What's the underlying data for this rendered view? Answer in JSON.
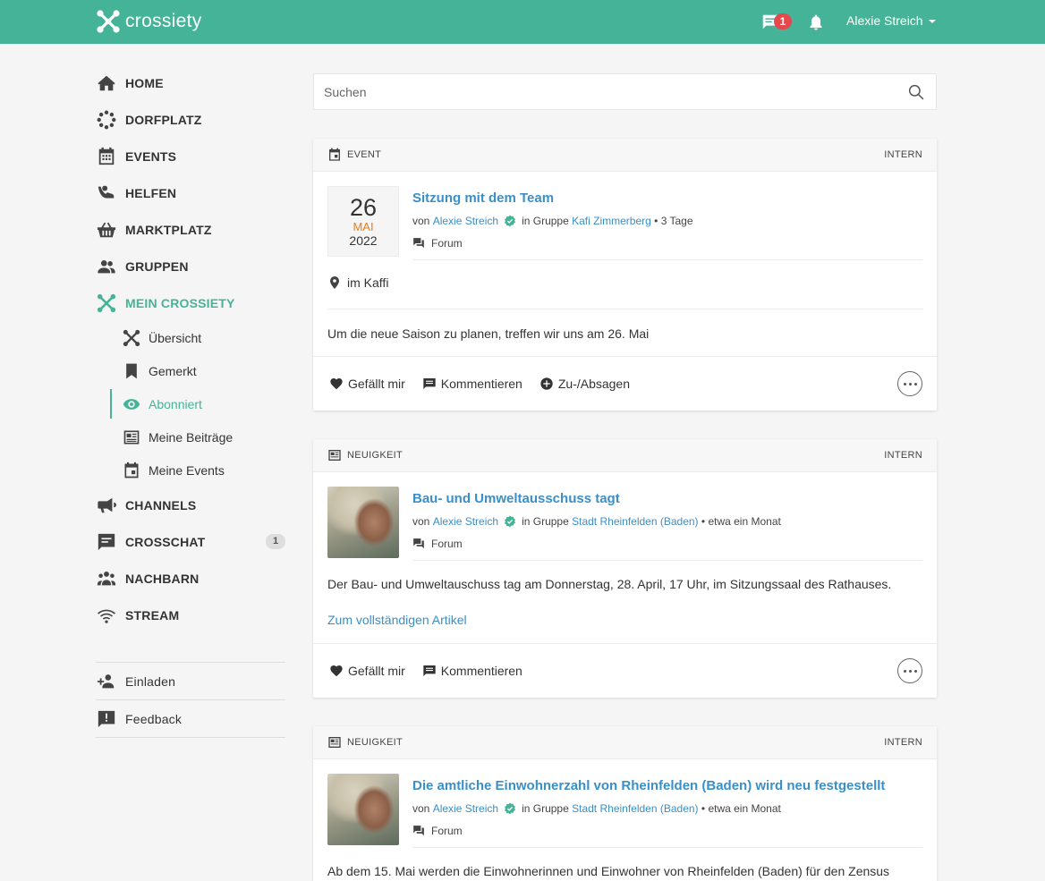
{
  "app": {
    "name": "crossiety",
    "brand_color": "#45b397",
    "message_count": "1",
    "user_name": "Alexie Streich"
  },
  "sidebar": {
    "items": [
      {
        "label": "HOME",
        "icon": "home-icon"
      },
      {
        "label": "DORFPLATZ",
        "icon": "dots-circle-icon"
      },
      {
        "label": "EVENTS",
        "icon": "calendar-icon"
      },
      {
        "label": "HELFEN",
        "icon": "helping-hand-icon"
      },
      {
        "label": "MARKTPLATZ",
        "icon": "basket-icon"
      },
      {
        "label": "GRUPPEN",
        "icon": "group-icon"
      },
      {
        "label": "MEIN CROSSIETY",
        "icon": "crossiety-icon"
      }
    ],
    "sub_items": [
      {
        "label": "Übersicht",
        "icon": "crossiety-icon"
      },
      {
        "label": "Gemerkt",
        "icon": "bookmark-icon"
      },
      {
        "label": "Abonniert",
        "icon": "eye-icon"
      },
      {
        "label": "Meine Beiträge",
        "icon": "newspaper-icon"
      },
      {
        "label": "Meine Events",
        "icon": "calendar-event-icon"
      }
    ],
    "items2": [
      {
        "label": "CHANNELS",
        "icon": "megaphone-icon"
      },
      {
        "label": "CROSSCHAT",
        "icon": "chat-icon",
        "count": "1"
      },
      {
        "label": "NACHBARN",
        "icon": "people-icon"
      },
      {
        "label": "STREAM",
        "icon": "wifi-icon"
      }
    ],
    "extras": [
      {
        "label": "Einladen",
        "icon": "add-person-icon"
      },
      {
        "label": "Feedback",
        "icon": "feedback-icon"
      }
    ]
  },
  "search": {
    "placeholder": "Suchen"
  },
  "posts": [
    {
      "type": "EVENT",
      "visibility": "INTERN",
      "date": {
        "day": "26",
        "month": "MAI",
        "year": "2022"
      },
      "title": "Sitzung mit dem Team",
      "by": "von",
      "author": "Alexie Streich",
      "in_group": "in Gruppe",
      "group": "Kafi Zimmerberg",
      "age": "• 3 Tage",
      "forum": "Forum",
      "location": "im Kaffi",
      "text": "Um die neue Saison zu planen, treffen wir uns am 26. Mai",
      "actions": [
        "Gefällt mir",
        "Kommentieren",
        "Zu-/Absagen"
      ]
    },
    {
      "type": "NEUIGKEIT",
      "visibility": "INTERN",
      "title": "Bau- und Umweltausschuss tagt",
      "by": "von",
      "author": "Alexie Streich",
      "in_group": "in Gruppe",
      "group": "Stadt Rheinfelden (Baden)",
      "age": "• etwa ein Monat",
      "forum": "Forum",
      "text": "Der Bau- und Umweltauschuss tag am Donnerstag, 28. April, 17 Uhr, im Sitzungssaal des Rathauses.",
      "link": "Zum vollständigen Artikel",
      "actions": [
        "Gefällt mir",
        "Kommentieren"
      ]
    },
    {
      "type": "NEUIGKEIT",
      "visibility": "INTERN",
      "title": "Die amtliche Einwohnerzahl von Rheinfelden (Baden) wird neu festgestellt",
      "by": "von",
      "author": "Alexie Streich",
      "in_group": "in Gruppe",
      "group": "Stadt Rheinfelden (Baden)",
      "age": "• etwa ein Monat",
      "forum": "Forum",
      "text": "Ab dem 15. Mai werden die Einwohnerinnen und Einwohner von Rheinfelden (Baden) für den Zensus"
    }
  ]
}
